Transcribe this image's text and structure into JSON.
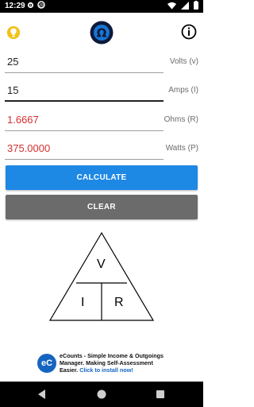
{
  "status_bar": {
    "time": "12:29"
  },
  "fields": [
    {
      "value": "25",
      "unit": "Volts (v)",
      "color": "normal"
    },
    {
      "value": "15",
      "unit": "Amps (I)",
      "color": "normal"
    },
    {
      "value": "1.6667",
      "unit": "Ohms (R)",
      "color": "red"
    },
    {
      "value": "375.0000",
      "unit": "Watts (P)",
      "color": "red"
    }
  ],
  "buttons": {
    "calculate": "CALCULATE",
    "clear": "CLEAR"
  },
  "triangle": {
    "top": "V",
    "bottom_left": "I",
    "bottom_right": "R"
  },
  "ad": {
    "logo_text": "eC",
    "text": "eCounts - Simple Income & Outgoings Manager. Making Self-Assessment Easier.",
    "cta": "Click to install now!"
  },
  "colors": {
    "calculate_button": "#1e88e5",
    "clear_button": "#6b6b6b",
    "result_text": "#d32f2f"
  },
  "icons": {
    "bulb": "lightbulb-icon",
    "logo": "omega-logo-icon",
    "info": "info-icon"
  }
}
